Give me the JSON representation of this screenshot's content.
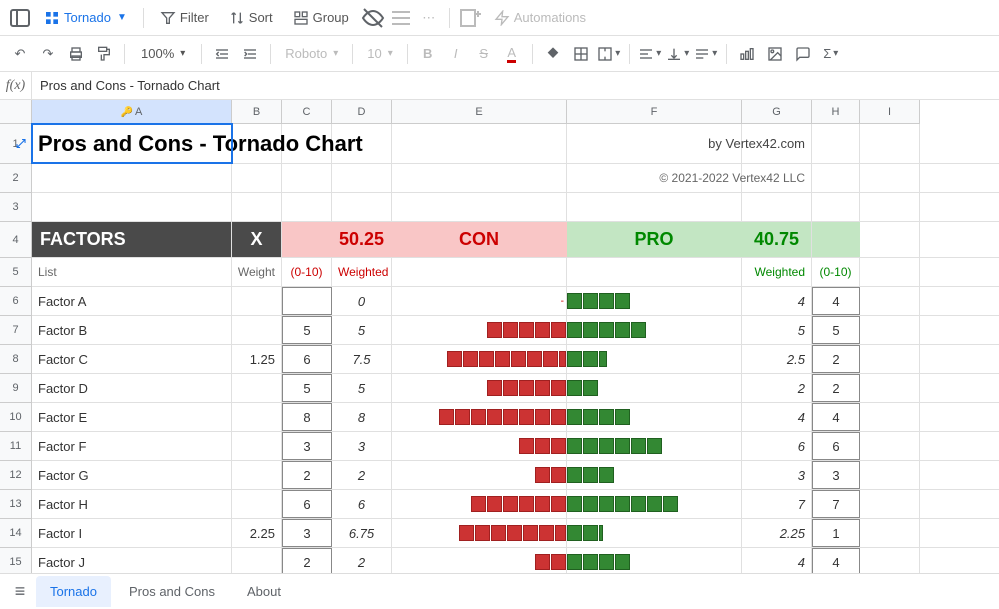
{
  "toolbar1": {
    "view_name": "Tornado",
    "filter": "Filter",
    "sort": "Sort",
    "group": "Group",
    "automations": "Automations"
  },
  "toolbar2": {
    "zoom": "100%",
    "font": "Roboto",
    "size": "10"
  },
  "formula_bar": {
    "fx": "f(x)",
    "value": "Pros and Cons - Tornado Chart"
  },
  "columns": [
    "A",
    "B",
    "C",
    "D",
    "E",
    "F",
    "G",
    "H",
    "I"
  ],
  "row_nums": [
    "1",
    "2",
    "3",
    "4",
    "5",
    "6",
    "7",
    "8",
    "9",
    "10",
    "11",
    "12",
    "13",
    "14",
    "15"
  ],
  "title": "Pros and Cons - Tornado Chart",
  "byline": "by Vertex42.com",
  "copyright": "© 2021-2022 Vertex42 LLC",
  "headers": {
    "factors": "FACTORS",
    "x": "X",
    "con_total": "50.25",
    "con": "CON",
    "pro": "PRO",
    "pro_total": "40.75"
  },
  "subheaders": {
    "list": "List",
    "weight": "Weight",
    "r010c": "(0-10)",
    "weighted_c": "Weighted",
    "weighted_p": "Weighted",
    "r010p": "(0-10)"
  },
  "rows": [
    {
      "a": "Factor A",
      "b": "",
      "c": "",
      "d": "0",
      "con": 0,
      "pro": 4,
      "g": "4",
      "h": "4"
    },
    {
      "a": "Factor B",
      "b": "",
      "c": "5",
      "d": "5",
      "con": 5,
      "pro": 5,
      "g": "5",
      "h": "5"
    },
    {
      "a": "Factor C",
      "b": "1.25",
      "c": "6",
      "d": "7.5",
      "con": 7.5,
      "pro": 2.5,
      "g": "2.5",
      "h": "2"
    },
    {
      "a": "Factor D",
      "b": "",
      "c": "5",
      "d": "5",
      "con": 5,
      "pro": 2,
      "g": "2",
      "h": "2"
    },
    {
      "a": "Factor E",
      "b": "",
      "c": "8",
      "d": "8",
      "con": 8,
      "pro": 4,
      "g": "4",
      "h": "4"
    },
    {
      "a": "Factor F",
      "b": "",
      "c": "3",
      "d": "3",
      "con": 3,
      "pro": 6,
      "g": "6",
      "h": "6"
    },
    {
      "a": "Factor G",
      "b": "",
      "c": "2",
      "d": "2",
      "con": 2,
      "pro": 3,
      "g": "3",
      "h": "3"
    },
    {
      "a": "Factor H",
      "b": "",
      "c": "6",
      "d": "6",
      "con": 6,
      "pro": 7,
      "g": "7",
      "h": "7"
    },
    {
      "a": "Factor I",
      "b": "2.25",
      "c": "3",
      "d": "6.75",
      "con": 6.75,
      "pro": 2.25,
      "g": "2.25",
      "h": "1"
    },
    {
      "a": "Factor J",
      "b": "",
      "c": "2",
      "d": "2",
      "con": 2,
      "pro": 4,
      "g": "4",
      "h": "4"
    }
  ],
  "tabs": [
    "Tornado",
    "Pros and Cons",
    "About"
  ],
  "chart_data": {
    "type": "bar",
    "title": "Pros and Cons - Tornado Chart",
    "categories": [
      "Factor A",
      "Factor B",
      "Factor C",
      "Factor D",
      "Factor E",
      "Factor F",
      "Factor G",
      "Factor H",
      "Factor I",
      "Factor J"
    ],
    "series": [
      {
        "name": "CON (Weighted)",
        "values": [
          0,
          5,
          7.5,
          5,
          8,
          3,
          2,
          6,
          6.75,
          2
        ]
      },
      {
        "name": "PRO (Weighted)",
        "values": [
          4,
          5,
          2.5,
          2,
          4,
          6,
          3,
          7,
          2.25,
          4
        ]
      }
    ],
    "con_total": 50.25,
    "pro_total": 40.75
  }
}
